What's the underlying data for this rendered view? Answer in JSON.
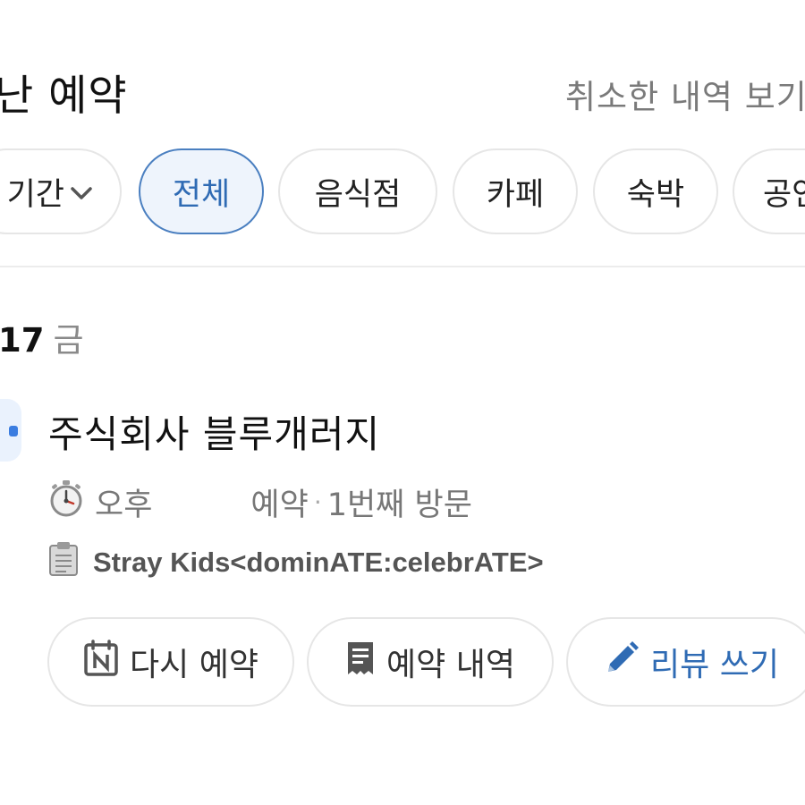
{
  "header": {
    "title": "난 예약",
    "cancelled_link": "취소한 내역 보기"
  },
  "filters": {
    "period_label": "기간",
    "chips": [
      "전체",
      "음식점",
      "카페",
      "숙박",
      "공연"
    ],
    "selected": "전체"
  },
  "reservation": {
    "date": ".17",
    "weekday": "금",
    "place_name": "주식회사 블루개러지",
    "time_label": "오후",
    "status": "예약",
    "separator": "·",
    "visit_count": "1번째 방문",
    "memo": "Stray Kids<dominATE:celebrATE>"
  },
  "actions": {
    "rebook_label": "다시 예약",
    "history_label": "예약 내역",
    "review_label": "리뷰 쓰기"
  },
  "icons": {
    "time": "stopwatch-icon",
    "memo": "clipboard-icon",
    "rebook": "calendar-n-icon",
    "history": "receipt-icon",
    "review": "pencil-icon",
    "period_dropdown": "chevron-down-icon"
  },
  "colors": {
    "accent": "#2f6bb4",
    "selected_chip_bg": "#eef4fc",
    "muted_text": "#7a7a7a"
  }
}
